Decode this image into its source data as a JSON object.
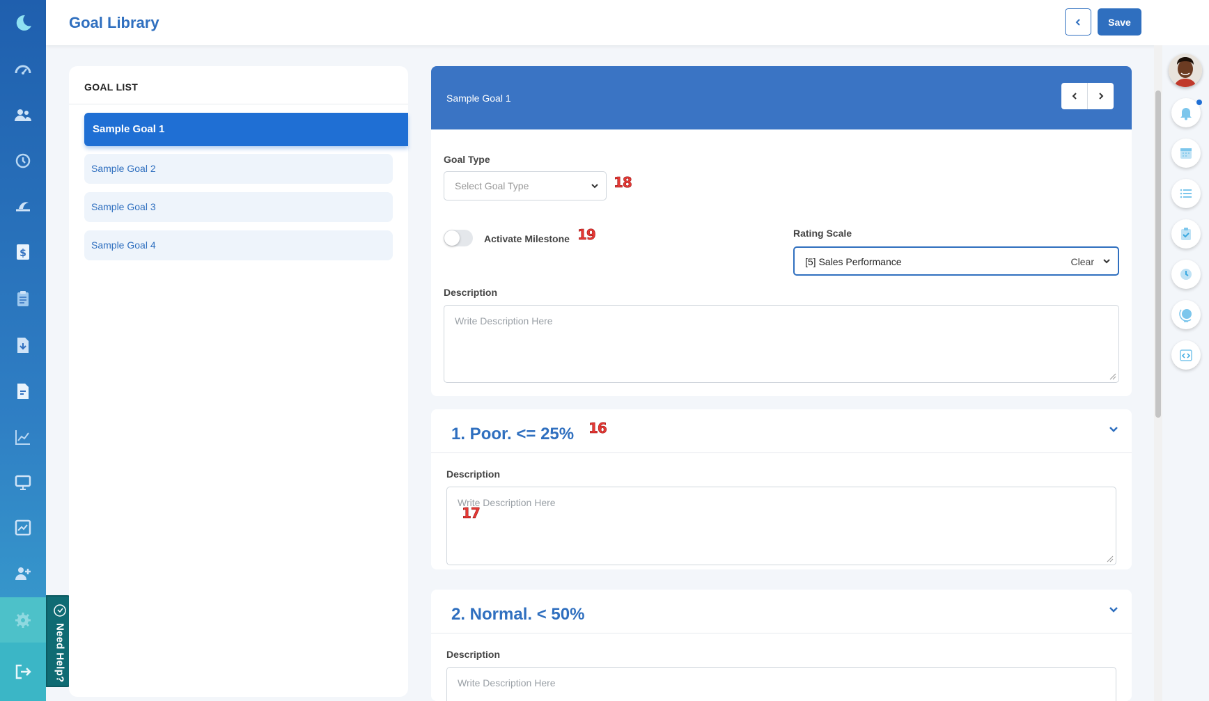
{
  "header": {
    "title": "Goal Library",
    "save_label": "Save"
  },
  "goal_list": {
    "title": "GOAL LIST",
    "items": [
      {
        "label": "Sample Goal 1",
        "active": true
      },
      {
        "label": "Sample Goal 2"
      },
      {
        "label": "Sample Goal 3"
      },
      {
        "label": "Sample Goal 4"
      }
    ]
  },
  "goal": {
    "title": "Sample Goal 1",
    "goal_type_label": "Goal Type",
    "goal_type_placeholder": "Select Goal Type",
    "activate_milestone_label": "Activate Milestone",
    "activate_milestone_on": false,
    "rating_scale_label": "Rating Scale",
    "rating_scale_value": "[5] Sales Performance",
    "rating_scale_clear": "Clear",
    "description_label": "Description",
    "description_placeholder": "Write Description Here"
  },
  "ratings": [
    {
      "title": "1. Poor. <= 25%",
      "description_label": "Description",
      "description_placeholder": "Write Description Here"
    },
    {
      "title": "2. Normal. < 50%",
      "description_label": "Description",
      "description_placeholder": "Write Description Here"
    }
  ],
  "annotations": {
    "goal_type": "18",
    "milestone": "19",
    "rating1_title": "16",
    "rating1_desc": "17"
  },
  "need_help": {
    "label": "Need Help?"
  },
  "colors": {
    "primary": "#2f6fbf",
    "active_item": "#1f6fd4",
    "goal_header": "#3a74c4",
    "badge": "#e53935"
  },
  "left_nav_icons": [
    "moon-logo-icon",
    "dashboard-icon",
    "people-icon",
    "history-icon",
    "leave-icon",
    "payroll-icon",
    "clipboard-icon",
    "document-download-icon",
    "document-icon",
    "chart-line-icon",
    "monitor-icon",
    "image-chart-icon",
    "add-user-icon",
    "settings-icon",
    "logout-icon"
  ],
  "right_rail_icons": [
    "avatar",
    "bell-icon",
    "calendar-icon",
    "list-icon",
    "clipboard-check-icon",
    "clock-icon",
    "globe-icon",
    "code-icon"
  ]
}
